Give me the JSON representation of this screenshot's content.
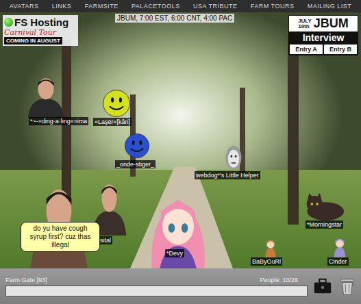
{
  "nav": [
    "AVATARS",
    "LINKS",
    "FARMSITE",
    "PALACETOOLS",
    "USA TRIBUTE",
    "FARM TOURS",
    "MAILING LIST"
  ],
  "signs": {
    "fs_logo": {
      "title": "FS Hosting",
      "subtitle": "Carnival Tour",
      "note": "COMING IN AUGUST"
    },
    "schedule": "JBUM, 7:00 EST, 6:00 CNT, 4:00 PAC",
    "interview": {
      "date": "JULY",
      "day": "19th",
      "title": "JBUM",
      "subtitle": "Interview",
      "entries": [
        "Entry A",
        "Entry B"
      ]
    }
  },
  "avatars": [
    {
      "name": "*~-»ding·a·ling«»ima",
      "kind": "photo",
      "color": "#2a2a2a"
    },
    {
      "name": "»Laşër«[kâri]",
      "kind": "smiley",
      "color": "#d4e21a"
    },
    {
      "name": "_onde-stiger_",
      "kind": "smiley",
      "color": "#2a4fd0"
    },
    {
      "name": "webdog*'s Little Helper",
      "kind": "face",
      "color": "#9a9a9a"
    },
    {
      "name": "*Morningstar",
      "kind": "cat",
      "color": "#3a2a26"
    },
    {
      "name": "**sital",
      "kind": "photo",
      "color": "#3a2f2a"
    },
    {
      "name": "*Devy",
      "kind": "anime",
      "color": "#f28fb0"
    },
    {
      "name": "BaByGuRl",
      "kind": "doll",
      "color": "#c87a3a"
    },
    {
      "name": "Cinder",
      "kind": "doll",
      "color": "#9a8fd0"
    },
    {
      "kind": "photo",
      "color": "#6a4a3a",
      "bubble": "do yu have cough syrup first? cuz thas illegal"
    }
  ],
  "status_bar": {
    "room": "Farm Gate [93]",
    "people": "People: 10/26"
  },
  "input": {
    "value": ""
  }
}
